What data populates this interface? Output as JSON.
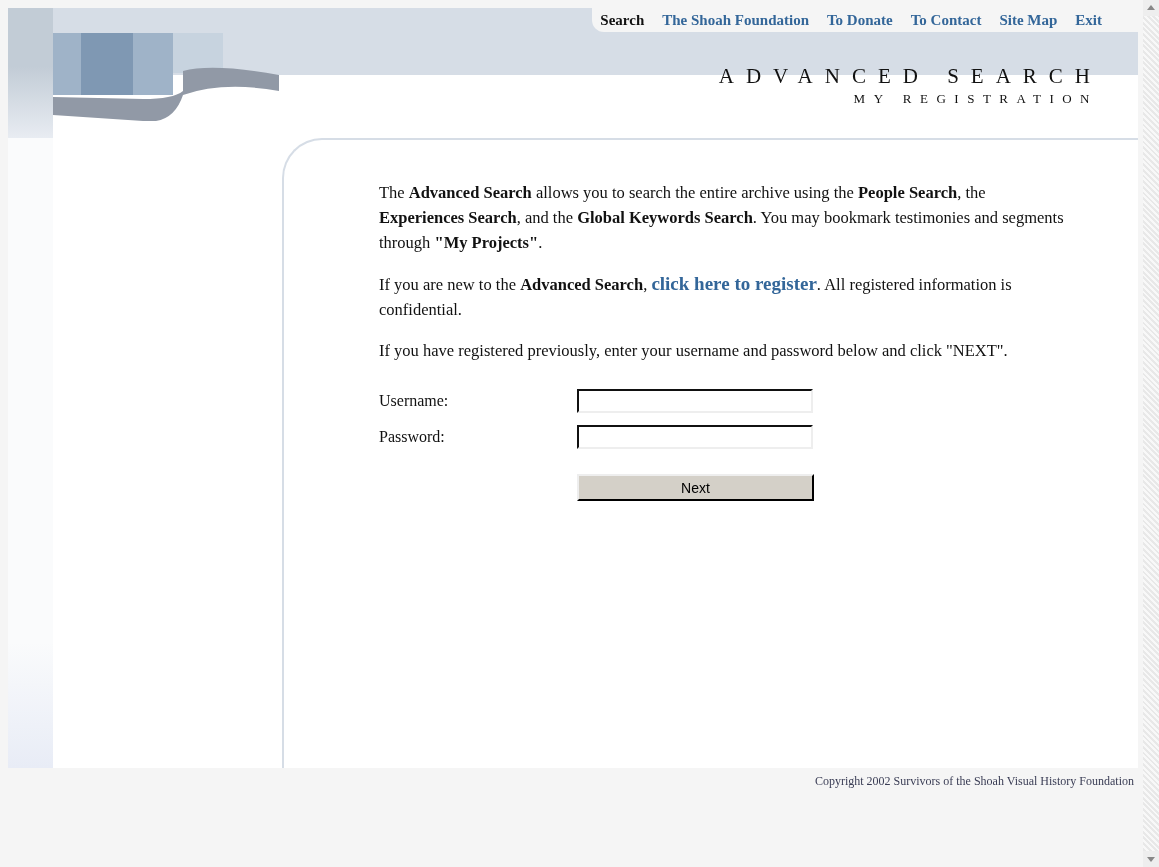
{
  "nav": [
    {
      "label": "Search",
      "selected": true
    },
    {
      "label": "The Shoah Foundation",
      "selected": false
    },
    {
      "label": "To Donate",
      "selected": false
    },
    {
      "label": "To Contact",
      "selected": false
    },
    {
      "label": "Site Map",
      "selected": false
    },
    {
      "label": "Exit",
      "selected": false
    }
  ],
  "title": "ADVANCED SEARCH",
  "subtitle": "MY REGISTRATION",
  "intro": "The **Advanced Search** allows you to search the entire archive using the **People Search**, the **Experiences Search**, and the **Global Keywords Search**. You may bookmark testimonies and segments through **\"My Projects\"**.",
  "register": {
    "before": "If you are new to the **Advanced Search**,",
    "link": "click here to register",
    "after": ". All registered information is confidential."
  },
  "instruction": "If you have registered previously, enter your username and password below and click \"NEXT\".",
  "fields": [
    {
      "label": "Username:"
    },
    {
      "label": "Password:"
    }
  ],
  "button": "Next",
  "copyright": "Copyright 2002 Survivors of the Shoah Visual History Foundation"
}
